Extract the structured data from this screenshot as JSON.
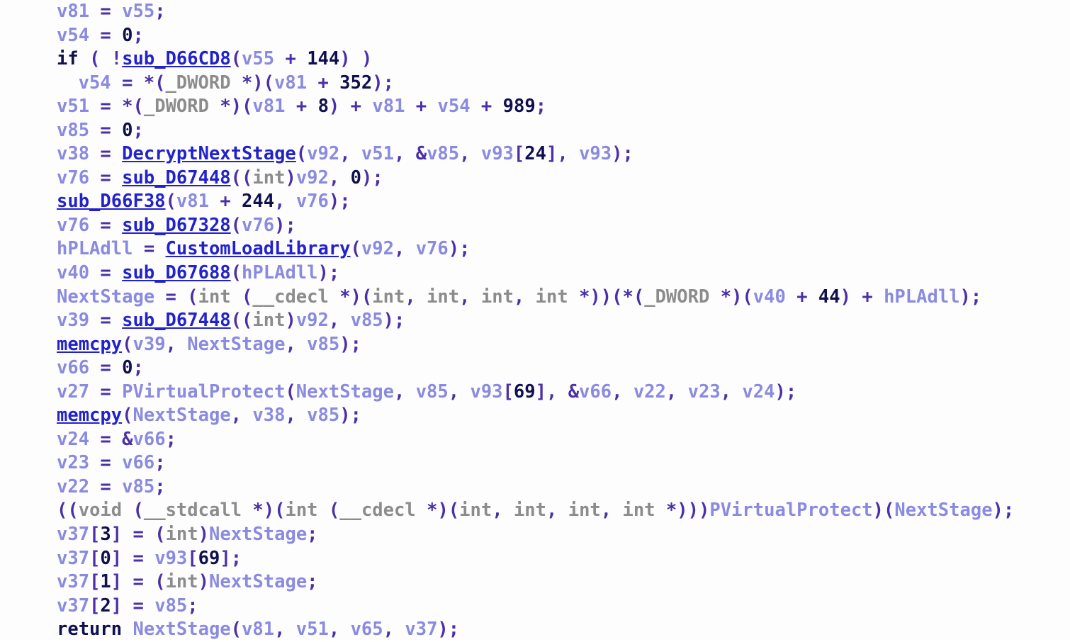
{
  "view": {
    "app": "IDA Pro",
    "panel": "Pseudocode",
    "language": "c-pseudocode",
    "background_color": "#fdfdfe",
    "colors": {
      "variable": "#8a8ae0",
      "function": "#2222cc",
      "keyword": "#10104f",
      "type": "#8c8c8c",
      "number": "#10104f",
      "punctuation": "#4b2fa8",
      "plain": "#10104f"
    }
  },
  "code": {
    "lines": [
      {
        "indent": 0,
        "text": "v81 = v55;"
      },
      {
        "indent": 0,
        "text": "v54 = 0;"
      },
      {
        "indent": 0,
        "text": "if ( !sub_D66CD8(v55 + 144) )"
      },
      {
        "indent": 1,
        "text": "v54 = *(_DWORD *)(v81 + 352);"
      },
      {
        "indent": 0,
        "text": "v51 = *(_DWORD *)(v81 + 8) + v81 + v54 + 989;"
      },
      {
        "indent": 0,
        "text": "v85 = 0;"
      },
      {
        "indent": 0,
        "text": "v38 = DecryptNextStage(v92, v51, &v85, v93[24], v93);"
      },
      {
        "indent": 0,
        "text": "v76 = sub_D67448((int)v92, 0);"
      },
      {
        "indent": 0,
        "text": "sub_D66F38(v81 + 244, v76);"
      },
      {
        "indent": 0,
        "text": "v76 = sub_D67328(v76);"
      },
      {
        "indent": 0,
        "text": "hPLAdll = CustomLoadLibrary(v92, v76);"
      },
      {
        "indent": 0,
        "text": "v40 = sub_D67688(hPLAdll);"
      },
      {
        "indent": 0,
        "text": "NextStage = (int (__cdecl *)(int, int, int, int *))(*(_DWORD *)(v40 + 44) + hPLAdll);"
      },
      {
        "indent": 0,
        "text": "v39 = sub_D67448((int)v92, v85);"
      },
      {
        "indent": 0,
        "text": "memcpy(v39, NextStage, v85);"
      },
      {
        "indent": 0,
        "text": "v66 = 0;"
      },
      {
        "indent": 0,
        "text": "v27 = PVirtualProtect(NextStage, v85, v93[69], &v66, v22, v23, v24);"
      },
      {
        "indent": 0,
        "text": "memcpy(NextStage, v38, v85);"
      },
      {
        "indent": 0,
        "text": "v24 = &v66;"
      },
      {
        "indent": 0,
        "text": "v23 = v66;"
      },
      {
        "indent": 0,
        "text": "v22 = v85;"
      },
      {
        "indent": 0,
        "text": "((void (__stdcall *)(int (__cdecl *)(int, int, int, int *)))PVirtualProtect)(NextStage);"
      },
      {
        "indent": 0,
        "text": "v37[3] = (int)NextStage;"
      },
      {
        "indent": 0,
        "text": "v37[0] = v93[69];"
      },
      {
        "indent": 0,
        "text": "v37[1] = (int)NextStage;"
      },
      {
        "indent": 0,
        "text": "v37[2] = v85;"
      },
      {
        "indent": 0,
        "text": "return NextStage(v81, v51, v65, v37);"
      }
    ],
    "symbols": {
      "functions": [
        "sub_D66CD8",
        "DecryptNextStage",
        "sub_D67448",
        "sub_D66F38",
        "sub_D67328",
        "CustomLoadLibrary",
        "sub_D67688",
        "memcpy"
      ],
      "variables": [
        "v81",
        "v55",
        "v54",
        "v51",
        "v85",
        "v38",
        "v76",
        "v92",
        "v93",
        "hPLAdll",
        "v40",
        "NextStage",
        "v39",
        "v66",
        "v27",
        "PVirtualProtect",
        "v22",
        "v23",
        "v24",
        "v37",
        "v65"
      ],
      "types": [
        "_DWORD",
        "int",
        "void",
        "__cdecl",
        "__stdcall"
      ],
      "keywords": [
        "if",
        "return"
      ],
      "numbers": [
        "144",
        "352",
        "8",
        "989",
        "0",
        "24",
        "244",
        "44",
        "69",
        "3",
        "1",
        "2"
      ]
    }
  }
}
